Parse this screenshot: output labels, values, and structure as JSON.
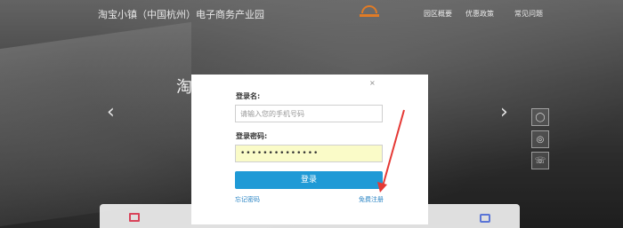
{
  "header": {
    "site_title": "淘宝小镇（中国杭州）电子商务产业园",
    "nav": [
      "园区概要",
      "优惠政策",
      "常见问题"
    ]
  },
  "hero": {
    "partial_text": "淘"
  },
  "login_modal": {
    "close_label": "×",
    "username_label": "登录名:",
    "username_placeholder": "请输入您的手机号码",
    "password_label": "登录密码:",
    "password_value": "••••••••••••••",
    "login_button": "登录",
    "forgot_link": "忘记密码",
    "register_link": "免费注册"
  },
  "colors": {
    "accent_blue": "#1f9ad6",
    "annotation_red": "#e53935",
    "logo_orange": "#e07b26",
    "autofill_yellow": "#fafbc8"
  },
  "icons": {
    "carousel_prev": "chevron-left-icon",
    "carousel_next": "chevron-right-icon",
    "side_buttons": [
      "qq-icon",
      "wechat-icon",
      "phone-icon"
    ]
  }
}
